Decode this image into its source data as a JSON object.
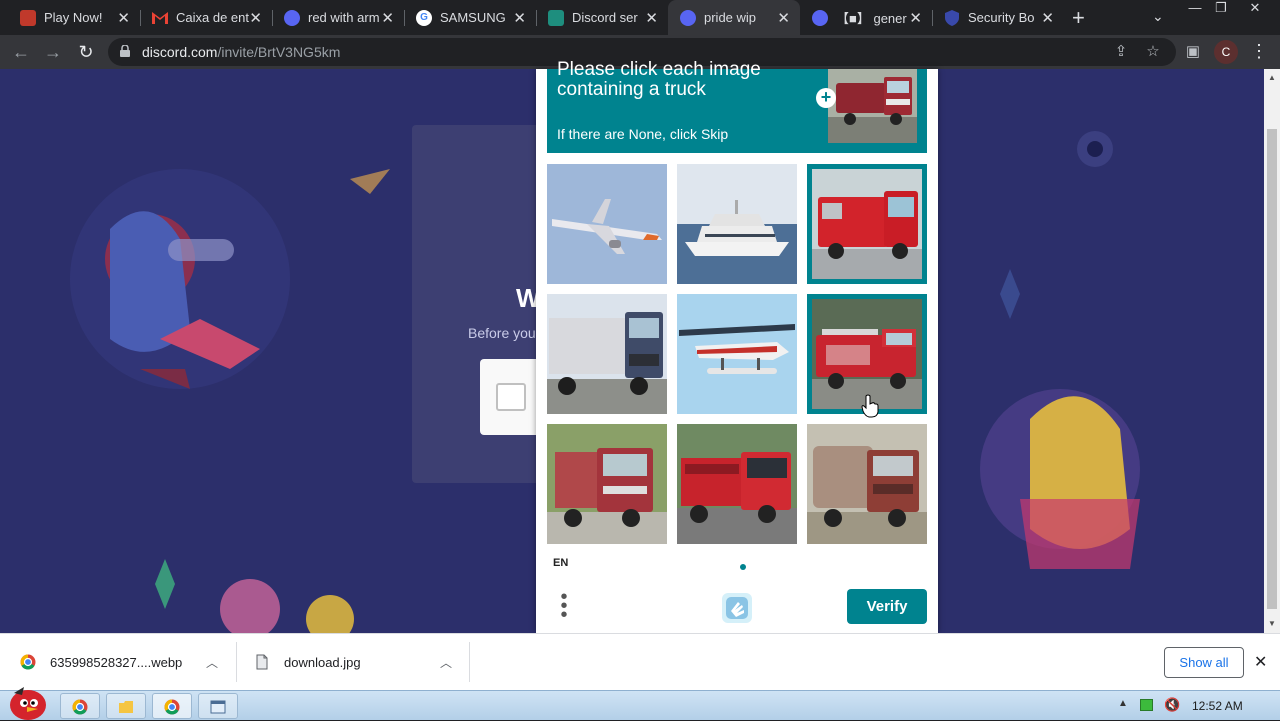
{
  "browser": {
    "tabs": [
      {
        "title": "Play Now!",
        "favicon": "game-favicon",
        "color": "#c0392b"
      },
      {
        "title": "Caixa de ent",
        "favicon": "gmail-favicon",
        "color": "#ea4335"
      },
      {
        "title": "red with arm",
        "favicon": "discord-favicon",
        "color": "#5865f2"
      },
      {
        "title": "SAMSUNG",
        "favicon": "google-favicon",
        "color": "#ffffff"
      },
      {
        "title": "Discord ser",
        "favicon": "sheet-favicon",
        "color": "#1e8e7e"
      },
      {
        "title": "pride wip",
        "favicon": "discord-favicon",
        "color": "#5865f2",
        "active": true
      },
      {
        "title": "【■】 gener",
        "favicon": "discord-favicon",
        "color": "#5865f2"
      },
      {
        "title": "Security Bo",
        "favicon": "shield-favicon",
        "color": "#3949ab"
      }
    ],
    "url_host": "discord.com",
    "url_path": "/invite/BrtV3NG5km",
    "profile_initial": "C"
  },
  "background": {
    "title": "W",
    "subtitle": "Before you"
  },
  "captcha": {
    "prompt_cut": "Please click each image",
    "prompt_main": "containing a truck",
    "prompt_sub": "If there are None, click Skip",
    "images": [
      {
        "label": "airplane",
        "selected": false
      },
      {
        "label": "yacht",
        "selected": false
      },
      {
        "label": "fire truck",
        "selected": true
      },
      {
        "label": "truck",
        "selected": false
      },
      {
        "label": "seaplane",
        "selected": false
      },
      {
        "label": "fire engine",
        "selected": true
      },
      {
        "label": "truck",
        "selected": false
      },
      {
        "label": "red truck",
        "selected": false
      },
      {
        "label": "truck",
        "selected": false
      }
    ],
    "language": "EN",
    "verify_label": "Verify",
    "accent": "#00838f"
  },
  "downloads": {
    "items": [
      {
        "name": "635998528327....webp"
      },
      {
        "name": "download.jpg"
      }
    ],
    "show_all": "Show all"
  },
  "taskbar": {
    "clock": "12:52 AM"
  }
}
